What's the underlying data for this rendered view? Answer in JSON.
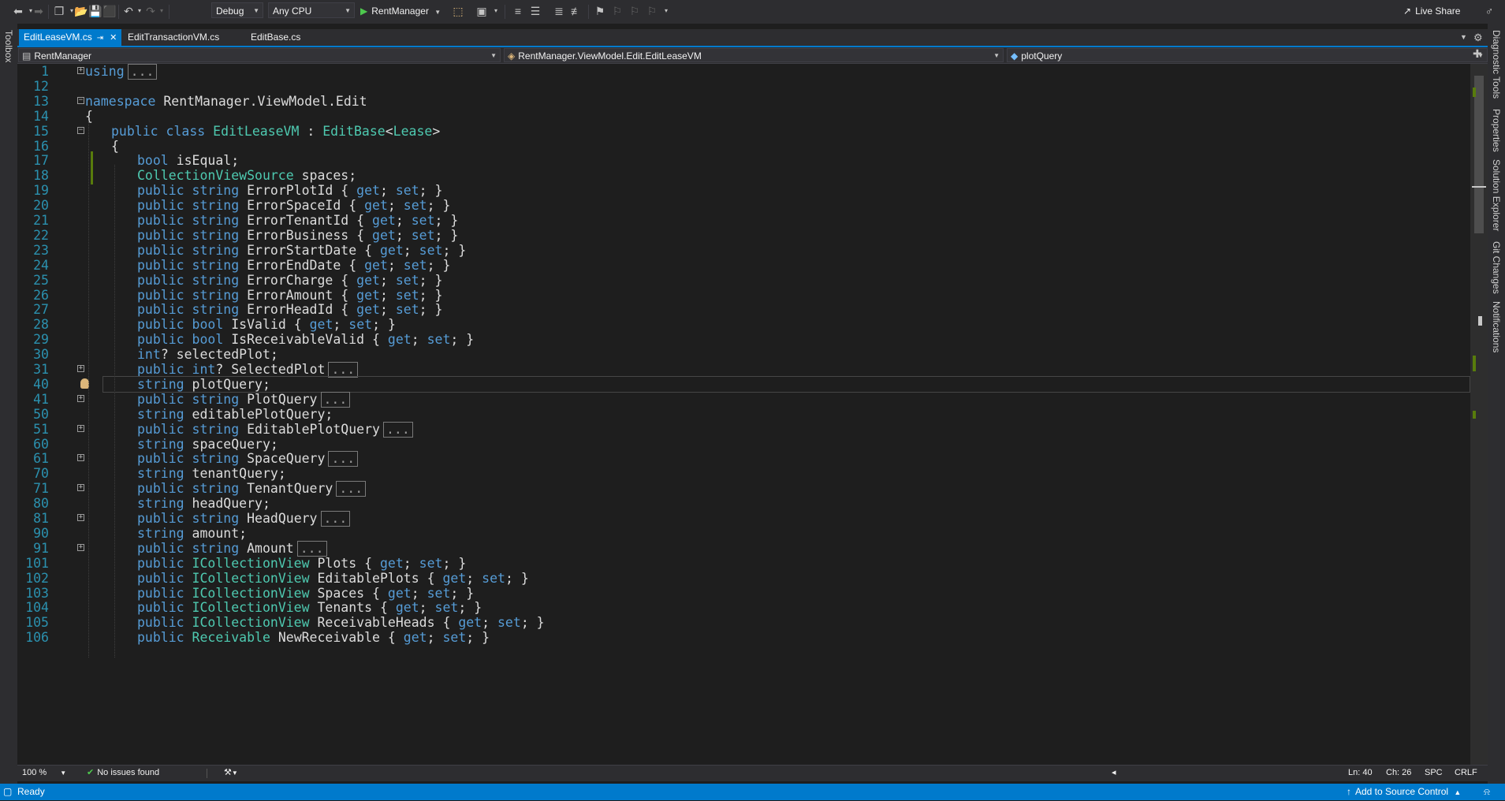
{
  "toolbar": {
    "configuration": "Debug",
    "platform": "Any CPU",
    "run_target": "RentManager",
    "live_share": "Live Share"
  },
  "side_panels": {
    "left": "Toolbox",
    "right": [
      "Diagnostic Tools",
      "Properties",
      "Solution Explorer",
      "Git Changes",
      "Notifications"
    ]
  },
  "tabs": [
    {
      "label": "EditLeaseVM.cs",
      "active": true
    },
    {
      "label": "EditTransactionVM.cs",
      "active": false
    },
    {
      "label": "EditBase.cs",
      "active": false
    }
  ],
  "navbar": {
    "project": "RentManager",
    "type": "RentManager.ViewModel.Edit.EditLeaseVM",
    "member": "plotQuery"
  },
  "editor": {
    "lines": [
      {
        "n": "1",
        "text": "using"
      },
      {
        "n": "12",
        "text": ""
      },
      {
        "n": "13",
        "text": "namespace RentManager.ViewModel.Edit"
      },
      {
        "n": "14",
        "text": "{"
      },
      {
        "n": "15",
        "text": "public class EditLeaseVM : EditBase<Lease>"
      },
      {
        "n": "16",
        "text": "{"
      },
      {
        "n": "17",
        "text": "bool isEqual;"
      },
      {
        "n": "18",
        "text": "CollectionViewSource spaces;"
      },
      {
        "n": "19",
        "text": "public string ErrorPlotId { get; set; }"
      },
      {
        "n": "20",
        "text": "public string ErrorSpaceId { get; set; }"
      },
      {
        "n": "21",
        "text": "public string ErrorTenantId { get; set; }"
      },
      {
        "n": "22",
        "text": "public string ErrorBusiness { get; set; }"
      },
      {
        "n": "23",
        "text": "public string ErrorStartDate { get; set; }"
      },
      {
        "n": "24",
        "text": "public string ErrorEndDate { get; set; }"
      },
      {
        "n": "25",
        "text": "public string ErrorCharge { get; set; }"
      },
      {
        "n": "26",
        "text": "public string ErrorAmount { get; set; }"
      },
      {
        "n": "27",
        "text": "public string ErrorHeadId { get; set; }"
      },
      {
        "n": "28",
        "text": "public bool IsValid { get; set; }"
      },
      {
        "n": "29",
        "text": "public bool IsReceivableValid { get; set; }"
      },
      {
        "n": "30",
        "text": "int? selectedPlot;"
      },
      {
        "n": "31",
        "text": "public int? SelectedPlot"
      },
      {
        "n": "40",
        "text": "string plotQuery;"
      },
      {
        "n": "41",
        "text": "public string PlotQuery"
      },
      {
        "n": "50",
        "text": "string editablePlotQuery;"
      },
      {
        "n": "51",
        "text": "public string EditablePlotQuery"
      },
      {
        "n": "60",
        "text": "string spaceQuery;"
      },
      {
        "n": "61",
        "text": "public string SpaceQuery"
      },
      {
        "n": "70",
        "text": "string tenantQuery;"
      },
      {
        "n": "71",
        "text": "public string TenantQuery"
      },
      {
        "n": "80",
        "text": "string headQuery;"
      },
      {
        "n": "81",
        "text": "public string HeadQuery"
      },
      {
        "n": "90",
        "text": "string amount;"
      },
      {
        "n": "91",
        "text": "public string Amount"
      },
      {
        "n": "101",
        "text": "public ICollectionView Plots { get; set; }"
      },
      {
        "n": "102",
        "text": "public ICollectionView EditablePlots { get; set; }"
      },
      {
        "n": "103",
        "text": "public ICollectionView Spaces { get; set; }"
      },
      {
        "n": "104",
        "text": "public ICollectionView Tenants { get; set; }"
      },
      {
        "n": "105",
        "text": "public ICollectionView ReceivableHeads { get; set; }"
      },
      {
        "n": "106",
        "text": "public Receivable NewReceivable { get; set; }"
      }
    ],
    "collapsed_marker": "..."
  },
  "editor_status": {
    "zoom": "100 %",
    "issues": "No issues found",
    "line": "Ln: 40",
    "char": "Ch: 26",
    "spacing": "SPC",
    "line_ending": "CRLF"
  },
  "statusbar": {
    "state": "Ready",
    "source_control": "Add to Source Control"
  },
  "colors": {
    "accent": "#007acc",
    "keyword": "#569cd6",
    "type": "#4ec9b0",
    "line_number": "#2b91af"
  }
}
